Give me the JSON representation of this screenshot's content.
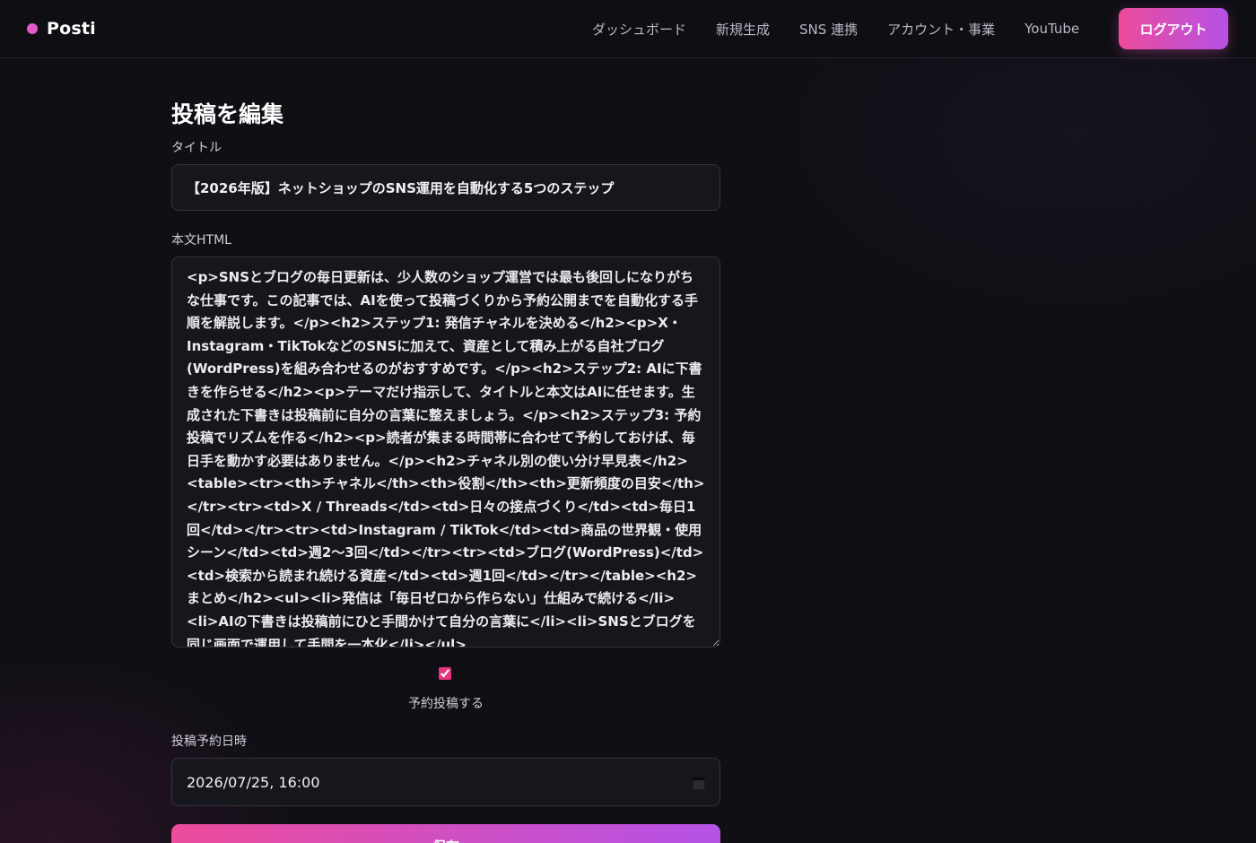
{
  "app": {
    "brand_name": "Posti",
    "brand_dot_color": "#e25cc9"
  },
  "nav": {
    "items": [
      {
        "label": "ダッシュボード"
      },
      {
        "label": "新規生成"
      },
      {
        "label": "SNS 連携"
      },
      {
        "label": "アカウント・事業"
      },
      {
        "label": "YouTube"
      }
    ],
    "logout_label": "ログアウト"
  },
  "form": {
    "page_title": "投稿を編集",
    "title_label": "タイトル",
    "title_value": "【2026年版】ネットショップのSNS運用を自動化する5つのステップ",
    "body_label": "本文HTML",
    "body_value": "<p>SNSとブログの毎日更新は、少人数のショップ運営では最も後回しになりがちな仕事です。この記事では、AIを使って投稿づくりから予約公開までを自動化する手順を解説します。</p><h2>ステップ1: 発信チャネルを決める</h2><p>X・Instagram・TikTokなどのSNSに加えて、資産として積み上がる自社ブログ(WordPress)を組み合わせるのがおすすめです。</p><h2>ステップ2: AIに下書きを作らせる</h2><p>テーマだけ指示して、タイトルと本文はAIに任せます。生成された下書きは投稿前に自分の言葉に整えましょう。</p><h2>ステップ3: 予約投稿でリズムを作る</h2><p>読者が集まる時間帯に合わせて予約しておけば、毎日手を動かす必要はありません。</p><h2>チャネル別の使い分け早見表</h2><table><tr><th>チャネル</th><th>役割</th><th>更新頻度の目安</th></tr><tr><td>X / Threads</td><td>日々の接点づくり</td><td>毎日1回</td></tr><tr><td>Instagram / TikTok</td><td>商品の世界観・使用シーン</td><td>週2〜3回</td></tr><tr><td>ブログ(WordPress)</td><td>検索から読まれ続ける資産</td><td>週1回</td></tr></table><h2>まとめ</h2><ul><li>発信は「毎日ゼロから作らない」仕組みで続ける</li><li>AIの下書きは投稿前にひと手間かけて自分の言葉に</li><li>SNSとブログを同じ画面で運用して手間を一本化</li></ul>",
    "schedule_checked": true,
    "schedule_label": "予約投稿する",
    "datetime_label": "投稿予約日時",
    "datetime_value": "2026/07/25, 16:00",
    "save_label": "保存"
  },
  "colors": {
    "accent_start": "#ec4c9b",
    "accent_end": "#b552e6",
    "background": "#0f0f14"
  }
}
